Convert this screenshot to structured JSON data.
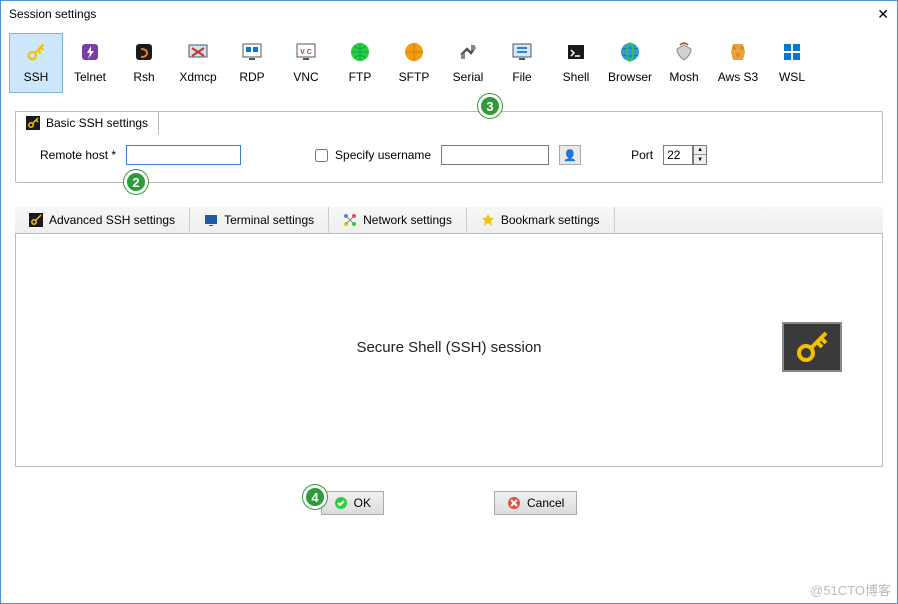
{
  "window": {
    "title": "Session settings"
  },
  "protocols": [
    {
      "name": "SSH"
    },
    {
      "name": "Telnet"
    },
    {
      "name": "Rsh"
    },
    {
      "name": "Xdmcp"
    },
    {
      "name": "RDP"
    },
    {
      "name": "VNC"
    },
    {
      "name": "FTP"
    },
    {
      "name": "SFTP"
    },
    {
      "name": "Serial"
    },
    {
      "name": "File"
    },
    {
      "name": "Shell"
    },
    {
      "name": "Browser"
    },
    {
      "name": "Mosh"
    },
    {
      "name": "Aws S3"
    },
    {
      "name": "WSL"
    }
  ],
  "basic": {
    "tab_label": "Basic SSH settings",
    "remote_host_label": "Remote host *",
    "remote_host_value": "",
    "specify_username_label": "Specify username",
    "username_value": "",
    "port_label": "Port",
    "port_value": "22"
  },
  "adv_tabs": {
    "advanced": "Advanced SSH settings",
    "terminal": "Terminal settings",
    "network": "Network settings",
    "bookmark": "Bookmark settings"
  },
  "session_description": "Secure Shell (SSH) session",
  "buttons": {
    "ok": "OK",
    "cancel": "Cancel"
  },
  "annotations": {
    "a2": "2",
    "a3": "3",
    "a4": "4"
  },
  "watermark": "@51CTO博客"
}
